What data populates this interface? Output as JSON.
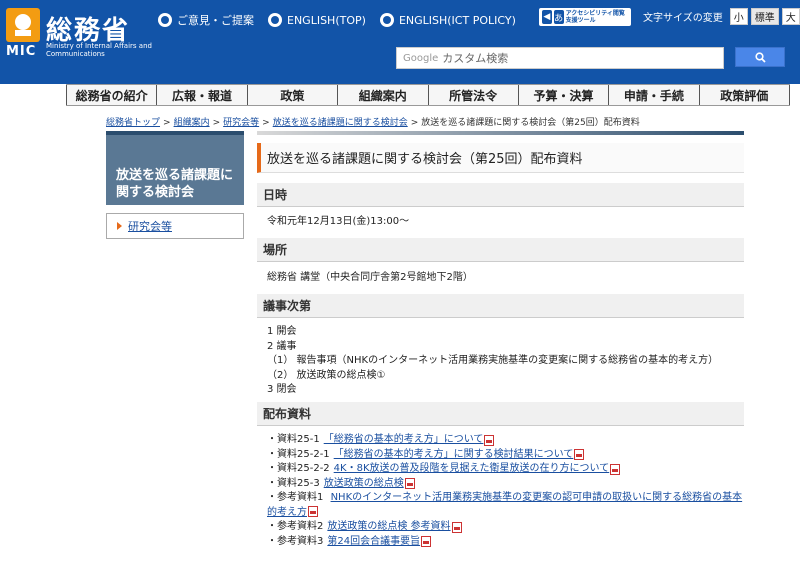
{
  "header": {
    "logo_jp": "総務省",
    "logo_mic": "MIC",
    "logo_en": "Ministry of Internal Affairs and Communications",
    "links": [
      {
        "label": "ご意見・ご提案"
      },
      {
        "label": "ENGLISH(TOP)"
      },
      {
        "label": "ENGLISH(ICT POLICY)"
      }
    ],
    "access_tool": "アクセシビリティ閲覧支援ツール",
    "font_size_label": "文字サイズの変更",
    "font_sizes": [
      "小",
      "標準",
      "大"
    ],
    "search_brand": "Google",
    "search_placeholder": "カスタム検索"
  },
  "nav": [
    "総務省の紹介",
    "広報・報道",
    "政策",
    "組織案内",
    "所管法令",
    "予算・決算",
    "申請・手続",
    "政策評価"
  ],
  "breadcrumb": {
    "items": [
      "総務省トップ",
      "組織案内",
      "研究会等",
      "放送を巡る諸課題に関する検討会"
    ],
    "current": "放送を巡る諸課題に関する検討会（第25回）配布資料"
  },
  "sidebar": {
    "title": "放送を巡る諸課題に関する検討会",
    "link": "研究会等"
  },
  "main": {
    "title": "放送を巡る諸課題に関する検討会（第25回）配布資料",
    "date_h": "日時",
    "date": "令和元年12月13日(金)13:00〜",
    "place_h": "場所",
    "place": "総務省 講堂（中央合同庁舎第2号館地下2階）",
    "agenda_h": "議事次第",
    "agenda": [
      "1 開会",
      "2 議事",
      "（1） 報告事項（NHKのインターネット活用業務実施基準の変更案に関する総務省の基本的考え方）",
      "（2） 放送政策の総点検①",
      "3 閉会"
    ],
    "materials_h": "配布資料",
    "materials": [
      {
        "label": "・資料25-1",
        "link": "「総務省の基本的考え方」について"
      },
      {
        "label": "・資料25-2-1",
        "link": "「総務省の基本的考え方」に関する検討結果について"
      },
      {
        "label": "・資料25-2-2",
        "link": "4K・8K放送の普及段階を見据えた衛星放送の在り方について"
      },
      {
        "label": "・資料25-3",
        "link": "放送政策の総点検"
      },
      {
        "label": "・参考資料1",
        "link": "NHKのインターネット活用業務実施基準の変更案の認可申請の取扱いに関する総務省の基本的考え方"
      },
      {
        "label": "・参考資料2",
        "link": "放送政策の総点検 参考資料"
      },
      {
        "label": "・参考資料3",
        "link": "第24回会合議事要旨"
      }
    ]
  }
}
